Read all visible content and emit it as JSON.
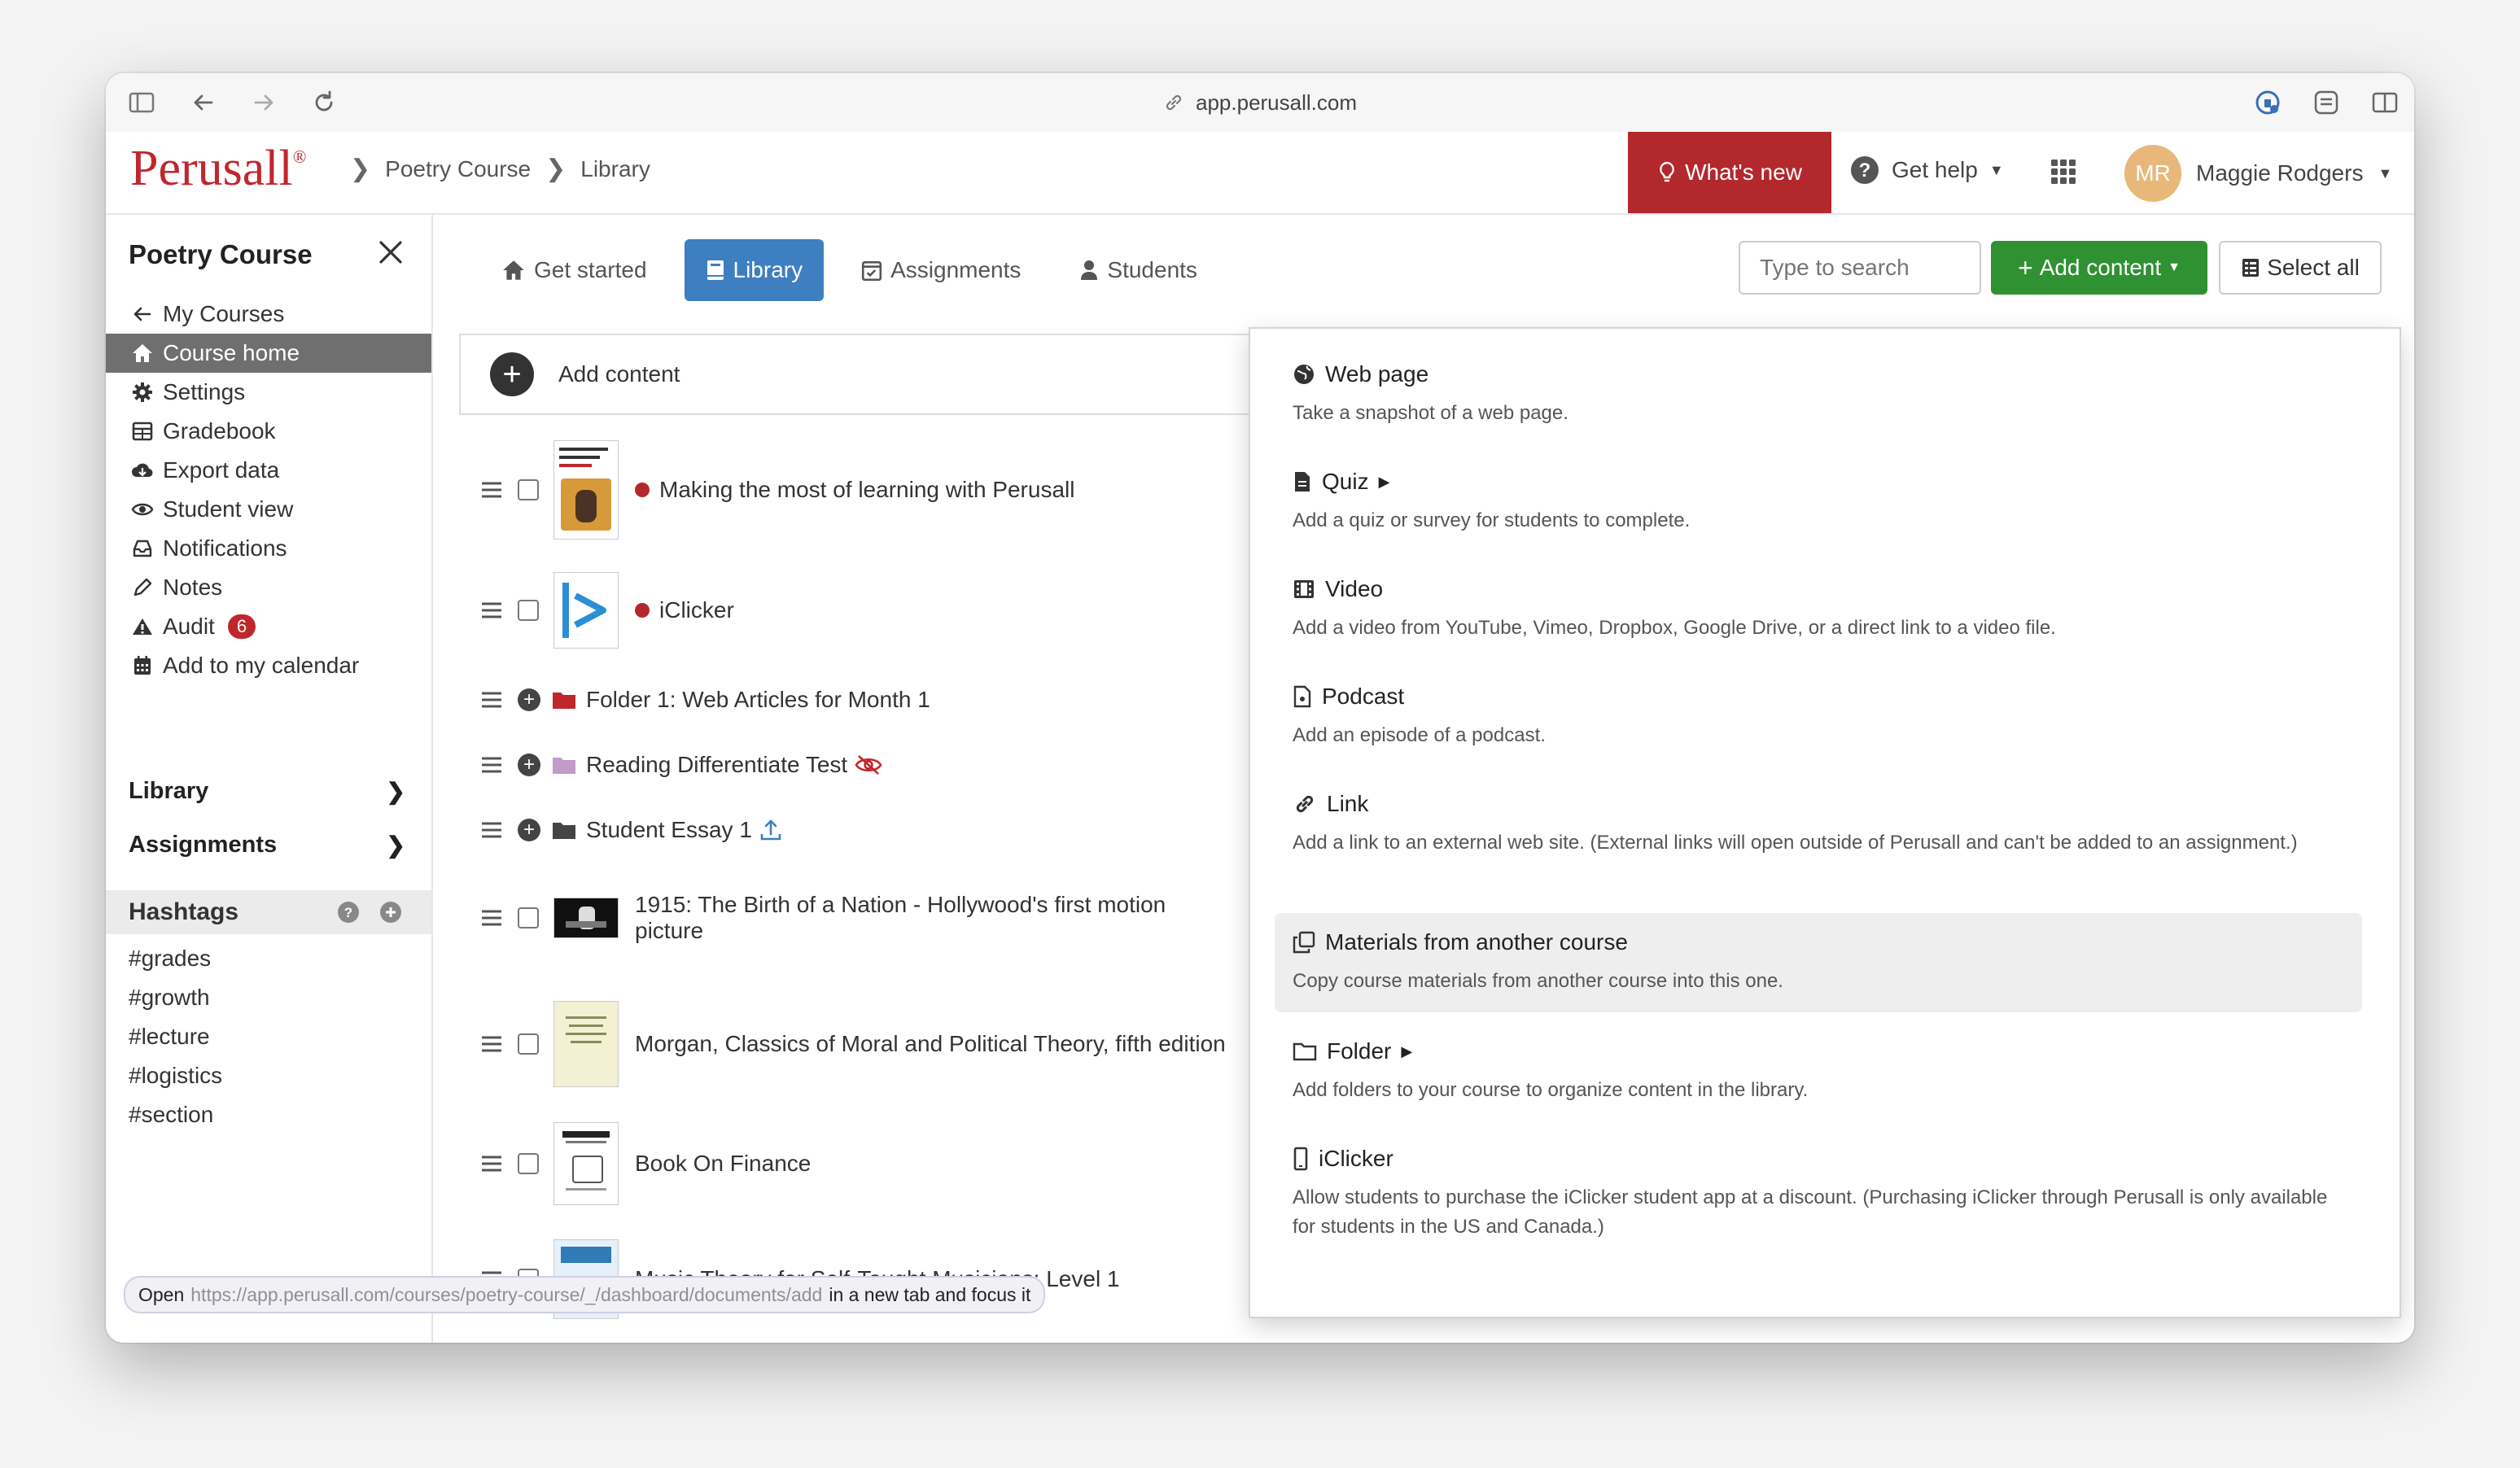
{
  "browser": {
    "url": "app.perusall.com"
  },
  "header": {
    "logo": "Perusall",
    "logo_mark": "®",
    "breadcrumbs": [
      "Poetry Course",
      "Library"
    ],
    "whats_new": "What's new",
    "get_help": "Get help",
    "user_initials": "MR",
    "user_name": "Maggie Rodgers",
    "accent_color": "#b3282d"
  },
  "sidebar": {
    "title": "Poetry Course",
    "items": [
      {
        "label": "My Courses",
        "icon": "arrow-left-icon"
      },
      {
        "label": "Course home",
        "icon": "home-icon"
      },
      {
        "label": "Settings",
        "icon": "gear-icon"
      },
      {
        "label": "Gradebook",
        "icon": "table-icon"
      },
      {
        "label": "Export data",
        "icon": "cloud-download-icon"
      },
      {
        "label": "Student view",
        "icon": "eye-icon"
      },
      {
        "label": "Notifications",
        "icon": "inbox-icon"
      },
      {
        "label": "Notes",
        "icon": "pencil-icon"
      },
      {
        "label": "Audit",
        "icon": "warning-icon",
        "badge": "6"
      },
      {
        "label": "Add to my calendar",
        "icon": "calendar-icon"
      }
    ],
    "sections": {
      "library": "Library",
      "assignments": "Assignments"
    },
    "hashtags_title": "Hashtags",
    "hashtags": [
      "#grades",
      "#growth",
      "#lecture",
      "#logistics",
      "#section"
    ]
  },
  "tabs": {
    "get_started": "Get started",
    "library": "Library",
    "assignments": "Assignments",
    "students": "Students"
  },
  "toolbar": {
    "search_placeholder": "Type to search",
    "add_content": "Add content",
    "select_all": "Select all"
  },
  "library": {
    "add_content_label": "Add content",
    "rows": [
      {
        "title": "Making the most of learning with Perusall"
      },
      {
        "title": "iClicker"
      },
      {
        "title": "Folder 1: Web Articles for Month 1"
      },
      {
        "title": "Reading Differentiate Test"
      },
      {
        "title": "Student Essay 1"
      },
      {
        "title": "1915: The Birth of a Nation - Hollywood's first motion picture"
      },
      {
        "title": "Morgan, Classics of Moral and Political Theory, fifth edition"
      },
      {
        "title": "Book On Finance"
      },
      {
        "title": "Music Theory for Self-Taught Musicians: Level 1"
      }
    ]
  },
  "dropdown": {
    "items": [
      {
        "label": "Web page",
        "desc": "Take a snapshot of a web page."
      },
      {
        "label": "Quiz",
        "desc": "Add a quiz or survey for students to complete."
      },
      {
        "label": "Video",
        "desc": "Add a video from YouTube, Vimeo, Dropbox, Google Drive, or a direct link to a video file."
      },
      {
        "label": "Podcast",
        "desc": "Add an episode of a podcast."
      },
      {
        "label": "Link",
        "desc": "Add a link to an external web site. (External links will open outside of Perusall and can't be added to an assignment.)"
      },
      {
        "label": "Materials from another course",
        "desc": "Copy course materials from another course into this one."
      },
      {
        "label": "Folder",
        "desc": "Add folders to your course to organize content in the library."
      },
      {
        "label": "iClicker",
        "desc": "Allow students to purchase the iClicker student app at a discount. (Purchasing iClicker through Perusall is only available for students in the US and Canada.)"
      }
    ]
  },
  "status_link": {
    "prefix": "Open",
    "url": "https://app.perusall.com/courses/poetry-course/_/dashboard/documents/add",
    "suffix": "in a new tab and focus it"
  }
}
